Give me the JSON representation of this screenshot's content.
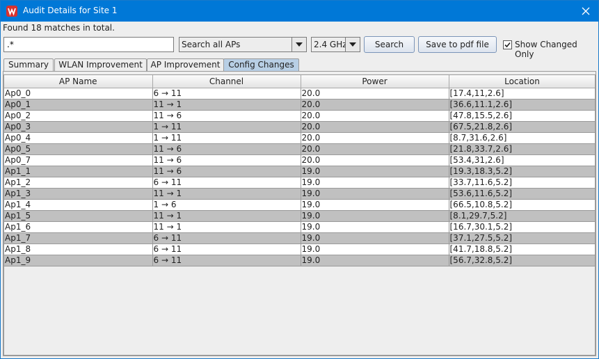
{
  "window": {
    "title": "Audit Details for Site 1"
  },
  "status_text": "Found 18 matches in total.",
  "search": {
    "value": ".*",
    "scope": "Search all APs",
    "band": "2.4 GHz",
    "search_label": "Search"
  },
  "toolbar": {
    "save_pdf_label": "Save to pdf file",
    "show_changed_label": "Show Changed Only",
    "show_changed_checked": true
  },
  "tabs": [
    {
      "label": "Summary"
    },
    {
      "label": "WLAN Improvement"
    },
    {
      "label": "AP Improvement"
    },
    {
      "label": "Config Changes",
      "active": true
    }
  ],
  "table": {
    "columns": [
      "AP Name",
      "Channel",
      "Power",
      "Location"
    ],
    "rows": [
      [
        "Ap0_0",
        "6 → 11",
        "20.0",
        "[17.4,11,2.6]"
      ],
      [
        "Ap0_1",
        "11 → 1",
        "20.0",
        "[36.6,11.1,2.6]"
      ],
      [
        "Ap0_2",
        "11 → 6",
        "20.0",
        "[47.8,15.5,2.6]"
      ],
      [
        "Ap0_3",
        "1 → 11",
        "20.0",
        "[67.5,21.8,2.6]"
      ],
      [
        "Ap0_4",
        "1 → 11",
        "20.0",
        "[8.7,31.6,2.6]"
      ],
      [
        "Ap0_5",
        "11 → 6",
        "20.0",
        "[21.8,33.7,2.6]"
      ],
      [
        "Ap0_7",
        "11 → 6",
        "20.0",
        "[53.4,31,2.6]"
      ],
      [
        "Ap1_1",
        "11 → 6",
        "19.0",
        "[19.3,18.3,5.2]"
      ],
      [
        "Ap1_2",
        "6 → 11",
        "19.0",
        "[33.7,11.6,5.2]"
      ],
      [
        "Ap1_3",
        "11 → 1",
        "19.0",
        "[53.6,11.6,5.2]"
      ],
      [
        "Ap1_4",
        "1 → 6",
        "19.0",
        "[66.5,10.8,5.2]"
      ],
      [
        "Ap1_5",
        "11 → 1",
        "19.0",
        "[8.1,29.7,5.2]"
      ],
      [
        "Ap1_6",
        "11 → 1",
        "19.0",
        "[16.7,30.1,5.2]"
      ],
      [
        "Ap1_7",
        "6 → 11",
        "19.0",
        "[37.1,27.5,5.2]"
      ],
      [
        "Ap1_8",
        "6 → 11",
        "19.0",
        "[41.7,18.8,5.2]"
      ],
      [
        "Ap1_9",
        "6 → 11",
        "19.0",
        "[56.7,32.8,5.2]"
      ]
    ]
  },
  "icons": {
    "app": "app-logo-icon",
    "close": "close-icon",
    "dropdown": "chevron-down-icon",
    "check": "check-icon"
  },
  "colors": {
    "titlebar": "#0078d7",
    "active_tab": "#b8cfe5",
    "row_alt": "#c0c0c0",
    "row": "#ffffff"
  }
}
